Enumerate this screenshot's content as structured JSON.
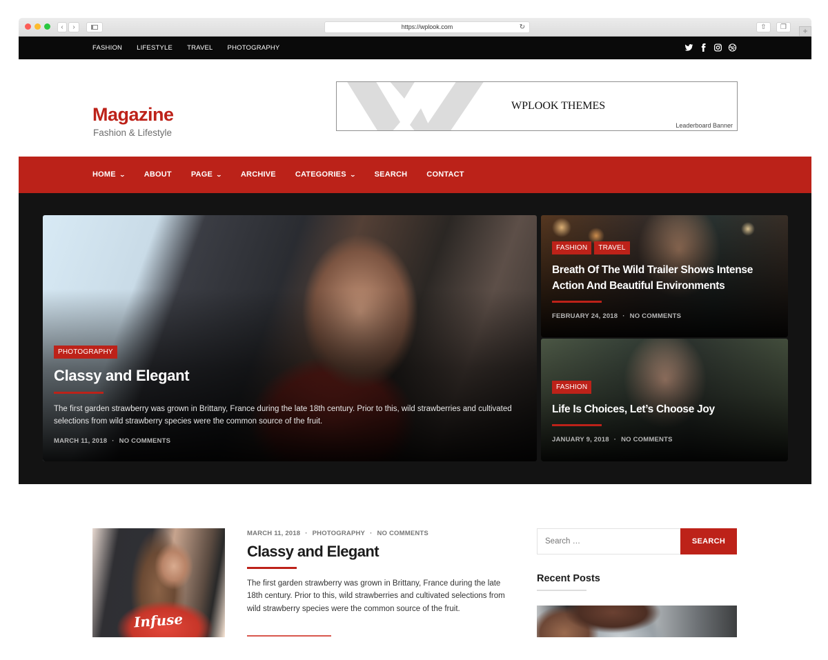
{
  "browser": {
    "url": "https://wplook.com",
    "nav_back_icon": "chevron-left-icon",
    "nav_forward_icon": "chevron-right-icon",
    "reload_icon": "reload-icon",
    "share_icon": "share-icon",
    "tabs_icon": "tabs-icon",
    "new_tab_label": "+"
  },
  "topbar": {
    "links": [
      "FASHION",
      "LIFESTYLE",
      "TRAVEL",
      "PHOTOGRAPHY"
    ],
    "social": [
      "twitter-icon",
      "facebook-icon",
      "instagram-icon",
      "dribbble-icon"
    ]
  },
  "header": {
    "site_title": "Magazine",
    "tagline": "Fashion & Lifestyle",
    "banner": {
      "title": "WPLOOK THEMES",
      "subtitle": "Leaderboard Banner"
    }
  },
  "mainnav": {
    "items": [
      {
        "label": "HOME",
        "dropdown": true
      },
      {
        "label": "ABOUT",
        "dropdown": false
      },
      {
        "label": "PAGE",
        "dropdown": true
      },
      {
        "label": "ARCHIVE",
        "dropdown": false
      },
      {
        "label": "CATEGORIES",
        "dropdown": true
      },
      {
        "label": "SEARCH",
        "dropdown": false
      },
      {
        "label": "CONTACT",
        "dropdown": false
      }
    ]
  },
  "featured": {
    "main": {
      "tags": [
        "PHOTOGRAPHY"
      ],
      "title": "Classy and Elegant",
      "excerpt": "The first garden strawberry was grown in Brittany, France during the late 18th century. Prior to this, wild strawberries and cultivated selections from wild strawberry species were the common source of the fruit.",
      "date": "MARCH 11, 2018",
      "comments": "NO COMMENTS"
    },
    "top": {
      "tags": [
        "FASHION",
        "TRAVEL"
      ],
      "title": "Breath Of The Wild Trailer Shows Intense Action And Beautiful Environments",
      "date": "FEBRUARY 24, 2018",
      "comments": "NO COMMENTS"
    },
    "bottom": {
      "tags": [
        "FASHION"
      ],
      "title": "Life Is Choices, Let’s Choose Joy",
      "date": "JANUARY 9, 2018",
      "comments": "NO COMMENTS"
    }
  },
  "post": {
    "date": "MARCH 11, 2018",
    "category": "PHOTOGRAPHY",
    "comments": "NO COMMENTS",
    "title": "Classy and Elegant",
    "excerpt": "The first garden strawberry was grown in Brittany, France during the late 18th century. Prior to this, wild strawberries and cultivated selections from wild strawberry species were the common source of the fruit.",
    "thumbnail_text": "Infuse"
  },
  "sidebar": {
    "search_placeholder": "Search …",
    "search_button": "SEARCH",
    "recent_posts_title": "Recent Posts"
  },
  "separator": "·",
  "colors": {
    "accent": "#bd2219",
    "topbar": "#0a0a0a",
    "featured_bg": "#131313"
  }
}
